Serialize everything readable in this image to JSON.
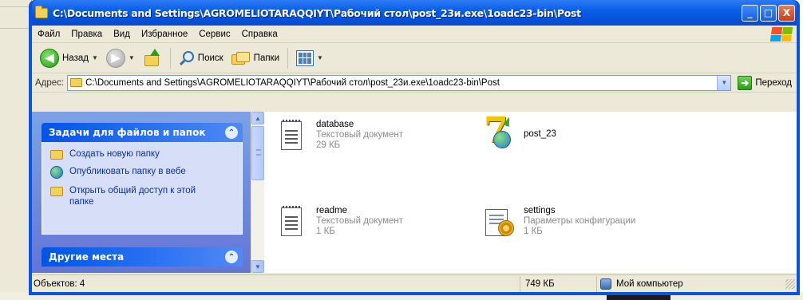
{
  "window": {
    "title": "C:\\Documents and Settings\\AGROMELIOTARAQQIYT\\Рабочий стол\\post_23и.exe\\1oadc23-bin\\Post",
    "minimize_label": "_",
    "maximize_label": "□",
    "close_label": "X"
  },
  "menu": {
    "items": [
      "Файл",
      "Правка",
      "Вид",
      "Избранное",
      "Сервис",
      "Справка"
    ]
  },
  "toolbar": {
    "back_label": "Назад",
    "search_label": "Поиск",
    "folders_label": "Папки"
  },
  "address": {
    "label": "Адрес:",
    "value": "C:\\Documents and Settings\\AGROMELIOTARAQQIYT\\Рабочий стол\\post_23и.exe\\1oadc23-bin\\Post",
    "go_label": "Переход"
  },
  "taskpane": {
    "tasks_title": "Задачи для файлов и папок",
    "tasks": [
      {
        "label": "Создать новую папку"
      },
      {
        "label": "Опубликовать папку в вебе"
      },
      {
        "label": "Открыть общий доступ к этой папке"
      }
    ],
    "places_title": "Другие места"
  },
  "files": [
    {
      "name": "database",
      "type": "Текстовый документ",
      "size": "29 КБ",
      "icon": "text-document-icon"
    },
    {
      "name": "post_23",
      "type": "",
      "size": "",
      "icon": "application-icon"
    },
    {
      "name": "readme",
      "type": "Текстовый документ",
      "size": "1 КБ",
      "icon": "text-document-icon"
    },
    {
      "name": "settings",
      "type": "Параметры конфигурации",
      "size": "1 КБ",
      "icon": "config-settings-icon"
    }
  ],
  "statusbar": {
    "objects": "Объектов: 4",
    "size": "749 КБ",
    "location": "Мой компьютер"
  },
  "colors": {
    "titlebar": "#0a5fe8",
    "taskpane": "#7ba2e7",
    "link": "#0c2e9e",
    "window_body": "#ece9d8"
  }
}
